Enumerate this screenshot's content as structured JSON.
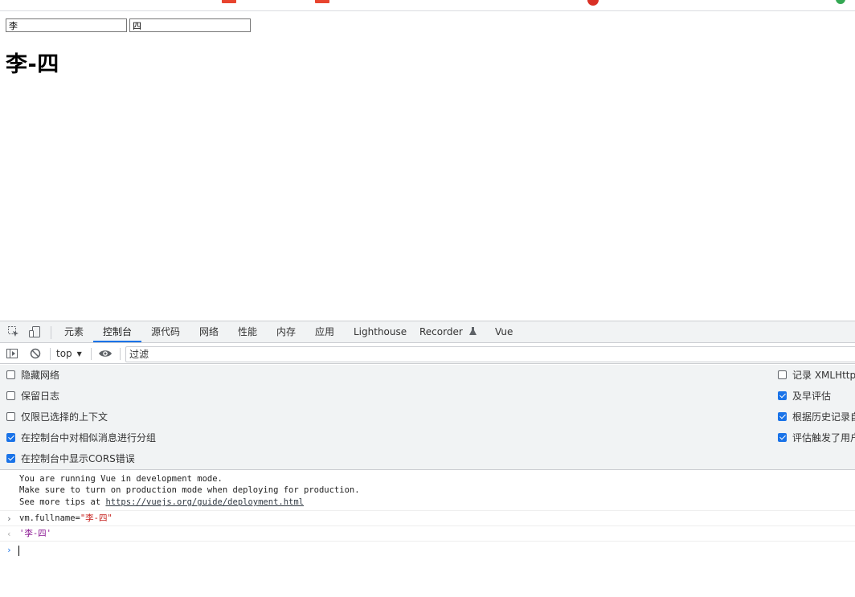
{
  "page": {
    "first_name_value": "李",
    "last_name_value": "四",
    "full_name": "李-四"
  },
  "devtools": {
    "tabs": [
      {
        "label": "元素"
      },
      {
        "label": "控制台"
      },
      {
        "label": "源代码"
      },
      {
        "label": "网络"
      },
      {
        "label": "性能"
      },
      {
        "label": "内存"
      },
      {
        "label": "应用"
      },
      {
        "label": "Lighthouse"
      },
      {
        "label": "Recorder"
      },
      {
        "label": "Vue"
      }
    ],
    "active_tab": "控制台",
    "context": "top",
    "filter_placeholder": "过滤",
    "settings_left": [
      {
        "label": "隐藏网络",
        "checked": false
      },
      {
        "label": "保留日志",
        "checked": false
      },
      {
        "label": "仅限已选择的上下文",
        "checked": false
      },
      {
        "label": "在控制台中对相似消息进行分组",
        "checked": true
      },
      {
        "label": "在控制台中显示CORS错误",
        "checked": true
      }
    ],
    "settings_right": [
      {
        "label": "记录 XMLHttpR",
        "checked": false
      },
      {
        "label": "及早评估",
        "checked": true
      },
      {
        "label": "根据历史记录自",
        "checked": true
      },
      {
        "label": "评估触发了用户",
        "checked": true
      }
    ],
    "console": {
      "vue_msg_line1": "You are running Vue in development mode.",
      "vue_msg_line2": "Make sure to turn on production mode when deploying for production.",
      "vue_msg_line3_prefix": "See more tips at ",
      "vue_msg_link": "https://vuejs.org/guide/deployment.html",
      "input_code_prefix": "vm.fullname=",
      "input_code_string": "\"李-四\"",
      "result": "'李-四'"
    }
  },
  "colors": {
    "accent": "#1a73e8",
    "devtools_bg": "#f1f3f4",
    "string_red": "#c41a16"
  }
}
